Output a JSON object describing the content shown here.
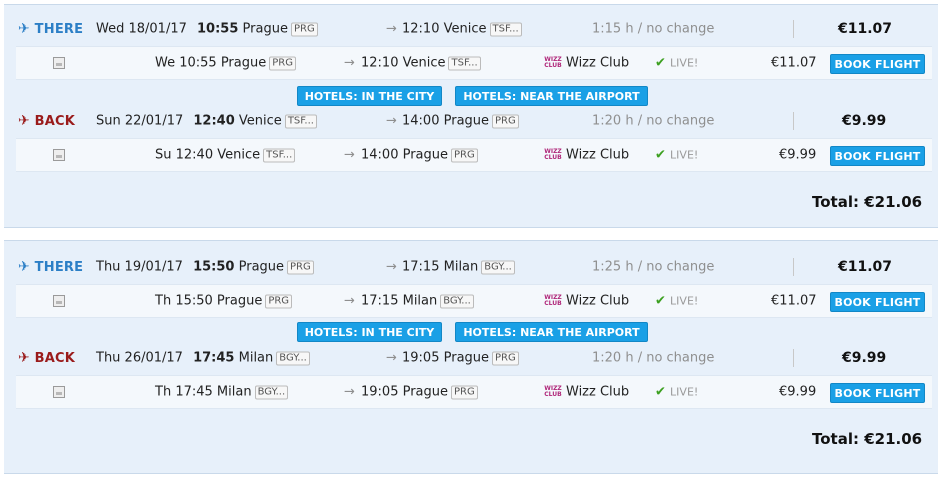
{
  "trips": [
    {
      "outbound": {
        "direction": "THERE",
        "date": "Wed 18/01/17",
        "time": "10:55",
        "from": "Prague",
        "from_code": "PRG",
        "to_time": "12:10",
        "to": "Venice",
        "to_code": "TSF...",
        "duration": "1:15 h / no change",
        "price": "€11.07",
        "detail": {
          "day_time": "We 10:55 Prague",
          "from_code": "PRG",
          "arr": "12:10 Venice",
          "to_code": "TSF...",
          "airline": "Wizz Club",
          "live": "LIVE!",
          "price": "€11.07",
          "book": "BOOK FLIGHT"
        }
      },
      "hotels": {
        "city": "HOTELS: IN THE CITY",
        "airport": "HOTELS: NEAR THE AIRPORT"
      },
      "return": {
        "direction": "BACK",
        "date": "Sun 22/01/17",
        "time": "12:40",
        "from": "Venice",
        "from_code": "TSF...",
        "to_time": "14:00",
        "to": "Prague",
        "to_code": "PRG",
        "duration": "1:20 h / no change",
        "price": "€9.99",
        "detail": {
          "day_time": "Su 12:40 Venice",
          "from_code": "TSF...",
          "arr": "14:00 Prague",
          "to_code": "PRG",
          "airline": "Wizz Club",
          "live": "LIVE!",
          "price": "€9.99",
          "book": "BOOK FLIGHT"
        }
      },
      "total": "Total: €21.06"
    },
    {
      "outbound": {
        "direction": "THERE",
        "date": "Thu 19/01/17",
        "time": "15:50",
        "from": "Prague",
        "from_code": "PRG",
        "to_time": "17:15",
        "to": "Milan",
        "to_code": "BGY...",
        "duration": "1:25 h / no change",
        "price": "€11.07",
        "detail": {
          "day_time": "Th 15:50 Prague",
          "from_code": "PRG",
          "arr": "17:15 Milan",
          "to_code": "BGY...",
          "airline": "Wizz Club",
          "live": "LIVE!",
          "price": "€11.07",
          "book": "BOOK FLIGHT"
        }
      },
      "hotels": {
        "city": "HOTELS: IN THE CITY",
        "airport": "HOTELS: NEAR THE AIRPORT"
      },
      "return": {
        "direction": "BACK",
        "date": "Thu 26/01/17",
        "time": "17:45",
        "from": "Milan",
        "from_code": "BGY...",
        "to_time": "19:05",
        "to": "Prague",
        "to_code": "PRG",
        "duration": "1:20 h / no change",
        "price": "€9.99",
        "detail": {
          "day_time": "Th 17:45 Milan",
          "from_code": "BGY...",
          "arr": "19:05 Prague",
          "to_code": "PRG",
          "airline": "Wizz Club",
          "live": "LIVE!",
          "price": "€9.99",
          "book": "BOOK FLIGHT"
        }
      },
      "total": "Total: €21.06"
    }
  ],
  "icons": {
    "there": "plane-takeoff-icon",
    "back": "plane-landing-icon",
    "arrow": "arrow-right-icon",
    "image": "image-placeholder-icon",
    "airline_logo": "wizz-air-logo",
    "check": "checkmark-icon"
  },
  "airline_logo_text": "WIZZ CLUB",
  "colors": {
    "there": "#2c7fc6",
    "back": "#9a1b1b",
    "button": "#1aa0e6",
    "card_bg": "#e7f0fa",
    "live_check": "#3ca020"
  }
}
